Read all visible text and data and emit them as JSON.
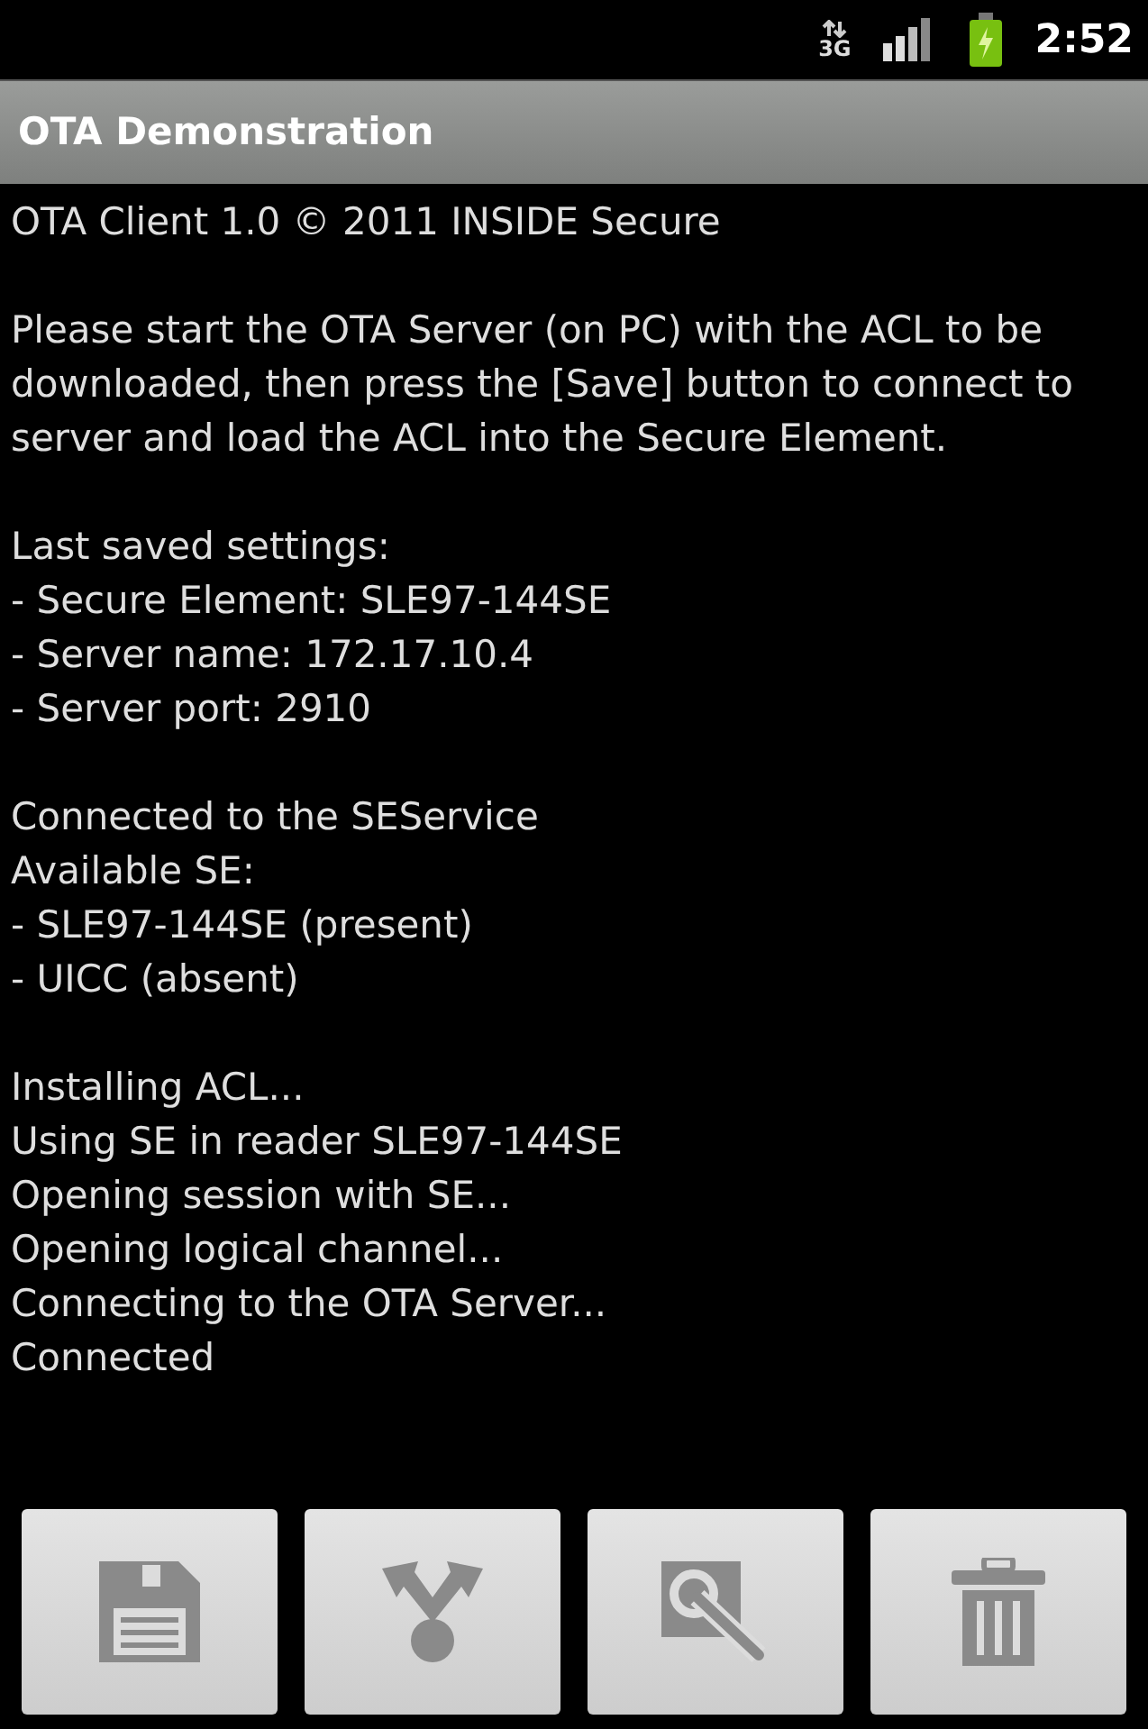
{
  "status_bar": {
    "network": "3G",
    "time": "2:52"
  },
  "title": "OTA Demonstration",
  "log": [
    {
      "kind": "lines",
      "lines": [
        "OTA Client 1.0 © 2011 INSIDE Secure"
      ]
    },
    {
      "kind": "paragraph",
      "text": "Please start the OTA Server (on PC) with the ACL to be downloaded, then press the [Save] button to connect to server and load the ACL into the Secure Element."
    },
    {
      "kind": "lines",
      "lines": [
        "Last saved settings:",
        "- Secure Element: SLE97-144SE",
        "- Server name: 172.17.10.4",
        "- Server port: 2910"
      ]
    },
    {
      "kind": "lines",
      "lines": [
        "Connected to the SEService",
        "Available SE:",
        "- SLE97-144SE (present)",
        "- UICC (absent)"
      ]
    },
    {
      "kind": "lines",
      "lines": [
        "Installing ACL...",
        "Using SE in reader SLE97-144SE",
        "Opening session with SE...",
        "Opening logical channel...",
        "Connecting to the OTA Server...",
        "Connected"
      ]
    }
  ],
  "buttons": [
    {
      "kind": "save"
    },
    {
      "kind": "download"
    },
    {
      "kind": "settings"
    },
    {
      "kind": "delete"
    }
  ]
}
